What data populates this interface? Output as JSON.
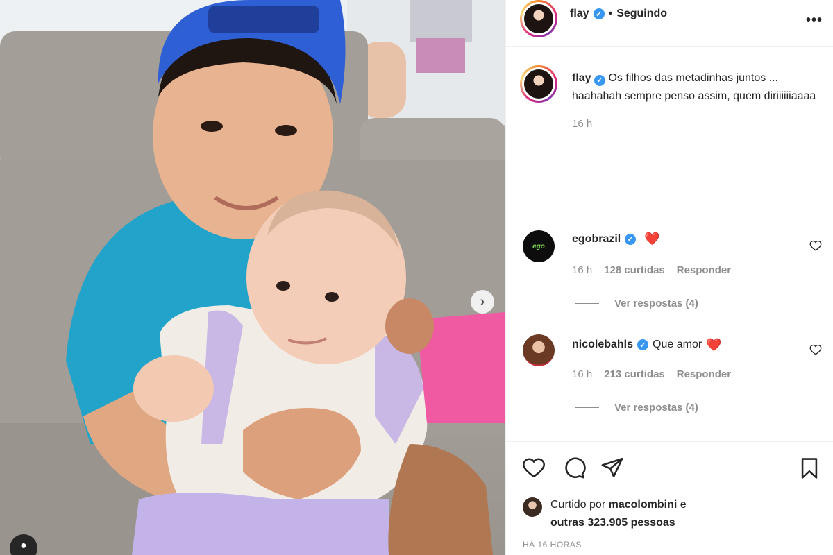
{
  "post": {
    "username": "flay",
    "follow_status": "Seguindo",
    "caption": "Os filhos das metadinhas juntos ... haahahah sempre penso assim, quem diriiiiiiaaaa",
    "time": "16 h"
  },
  "comments": [
    {
      "username": "egobrazil",
      "text": "",
      "emoji": "❤️",
      "time": "16 h",
      "likes": "128 curtidas",
      "reply_label": "Responder",
      "view_replies": "Ver respostas (4)"
    },
    {
      "username": "nicolebahls",
      "text": "Que amor",
      "emoji": "❤️",
      "time": "16 h",
      "likes": "213 curtidas",
      "reply_label": "Responder",
      "view_replies": "Ver respostas (4)"
    }
  ],
  "likes_summary": {
    "prefix": "Curtido por",
    "user": "macolombini",
    "suffix": "e",
    "others": "outras 323.905 pessoas"
  },
  "posted_time": "HÁ 16 HORAS",
  "icons": {
    "like": "heart-icon",
    "comment": "comment-icon",
    "share": "paper-plane-icon",
    "save": "bookmark-icon",
    "more": "more-options-icon",
    "next": "chevron-right-icon",
    "tag": "user-tag-icon",
    "verified": "verified-badge-icon"
  },
  "colors": {
    "verified": "#3897f0",
    "heart": "#ed4956",
    "muted": "#8e8e8e",
    "text": "#262626"
  }
}
